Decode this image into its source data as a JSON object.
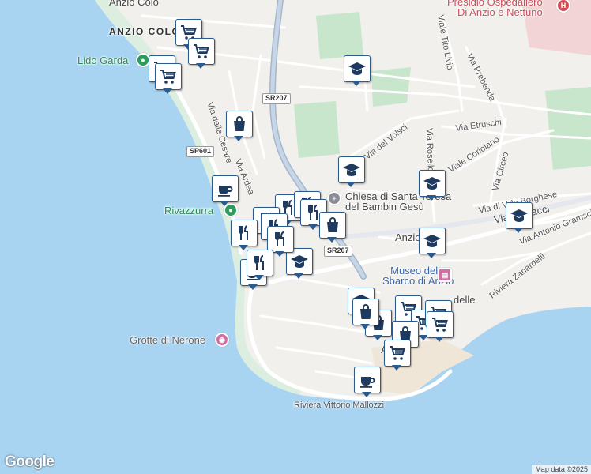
{
  "labels": {
    "hospital": "Presidio Ospedaliero\nDi Anzio e Nettuno",
    "anzio_colonia_top": "Anzio Colo",
    "anzio_colonia": "ANZIO COLO",
    "lido_garda": "Lido Garda",
    "via_delle_cesare": "Via delle Cesare",
    "via_ardea": "Via Ardea",
    "sp601": "SP601",
    "sr207_top": "SR207",
    "sr207_bottom": "SR207",
    "rivazzurra": "Rivazzurra",
    "chiesa": "Chiesa di Santa Teresa\ndel Bambin Gesù",
    "via_del_volsci": "Via del Volsci",
    "viale_tito_livio": "Viale Tito Livio",
    "via_prebenda": "Via Prebenda",
    "via_etruschi": "Via Etruschi",
    "via_rosello": "Via Rosello",
    "viale_coriolano": "Viale Coriolano",
    "via_circeo": "Via Circeo",
    "via_villa_borghese": "Via di Villa Borghese",
    "via_ciacacci": "Via Ciacacci",
    "via_antonio_gramsci": "Via Antonio Gramsci",
    "anzio": "Anzio",
    "museo": "Museo dello\nSbarco di Anzio",
    "delle": "delle",
    "riviera_zanardelli": "Riviera Zanardelli",
    "grotte_di_nerone": "Grotte di Nerone",
    "riviera_mallozzi": "Riviera Vittorio Mallozzi",
    "anzio_small": "A"
  },
  "footer": {
    "google": "Google",
    "attribution": "Map data ©2025"
  },
  "colors": {
    "sea": "#a8d4f2",
    "land": "#f1f0ec",
    "park": "#c8e6cc",
    "beach": "#dceee0",
    "road": "#ffffff",
    "main_road": "#a4b7cc",
    "marker_border": "#2b5b8c",
    "marker_icon": "#1e3a5f"
  },
  "markers": [
    {
      "type": "cart-icon"
    },
    {
      "type": "cart-icon"
    },
    {
      "type": "cart-icon"
    },
    {
      "type": "cart-icon"
    },
    {
      "type": "bag-icon"
    },
    {
      "type": "coffee-icon"
    },
    {
      "type": "school-icon"
    },
    {
      "type": "school-icon"
    },
    {
      "type": "school-icon"
    },
    {
      "type": "school-icon"
    },
    {
      "type": "school-icon"
    },
    {
      "type": "school-icon"
    },
    {
      "type": "restaurant-icon"
    },
    {
      "type": "restaurant-icon"
    },
    {
      "type": "restaurant-icon"
    },
    {
      "type": "restaurant-icon"
    },
    {
      "type": "restaurant-icon"
    },
    {
      "type": "restaurant-icon"
    },
    {
      "type": "restaurant-icon"
    },
    {
      "type": "bag-icon"
    },
    {
      "type": "coffee-icon"
    },
    {
      "type": "restaurant-icon"
    },
    {
      "type": "school-icon"
    },
    {
      "type": "bag-icon"
    },
    {
      "type": "bag-icon"
    },
    {
      "type": "cart-icon"
    },
    {
      "type": "cart-icon"
    },
    {
      "type": "cart-icon"
    },
    {
      "type": "bag-icon"
    },
    {
      "type": "cart-icon"
    },
    {
      "type": "coffee-icon"
    },
    {
      "type": "cart-icon"
    }
  ]
}
